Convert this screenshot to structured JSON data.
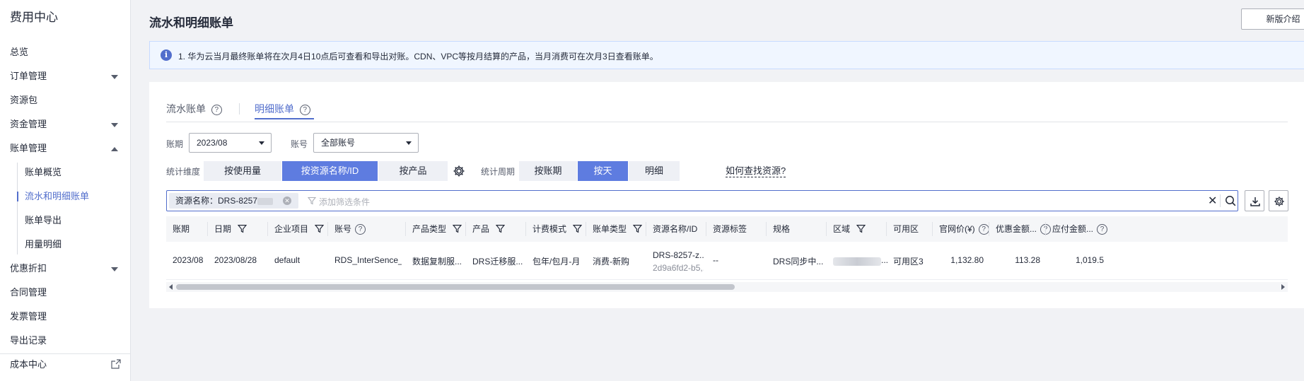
{
  "sidebar": {
    "title": "费用中心",
    "items": [
      {
        "label": "总览",
        "type": "top"
      },
      {
        "label": "订单管理",
        "type": "top",
        "caret": "down"
      },
      {
        "label": "资源包",
        "type": "top"
      },
      {
        "label": "资金管理",
        "type": "top",
        "caret": "down"
      },
      {
        "label": "账单管理",
        "type": "top",
        "caret": "up"
      },
      {
        "label": "账单概览",
        "type": "sub"
      },
      {
        "label": "流水和明细账单",
        "type": "sub",
        "active": true
      },
      {
        "label": "账单导出",
        "type": "sub"
      },
      {
        "label": "用量明细",
        "type": "sub"
      },
      {
        "label": "优惠折扣",
        "type": "top",
        "caret": "down"
      },
      {
        "label": "合同管理",
        "type": "top"
      },
      {
        "label": "发票管理",
        "type": "top"
      },
      {
        "label": "导出记录",
        "type": "top"
      },
      {
        "label": "成本中心",
        "type": "top",
        "external": true
      }
    ]
  },
  "header": {
    "title": "流水和明细账单",
    "intro_button": "新版介绍"
  },
  "notice": {
    "icon": "info-icon",
    "text": "1. 华为云当月最终账单将在次月4日10点后可查看和导出对账。CDN、VPC等按月结算的产品，当月消费可在次月3日查看账单。"
  },
  "tabs": [
    {
      "label": "流水账单",
      "active": false
    },
    {
      "label": "明细账单",
      "active": true
    }
  ],
  "filters": {
    "period_label": "账期",
    "period_value": "2023/08",
    "account_label": "账号",
    "account_value": "全部账号",
    "dimension_label": "统计维度",
    "dimensions": [
      "按使用量",
      "按资源名称/ID",
      "按产品"
    ],
    "dimension_active": 1,
    "cycle_label": "统计周期",
    "cycles": [
      "按账期",
      "按天",
      "明细"
    ],
    "cycle_active": 1,
    "find_resource_link": "如何查找资源?"
  },
  "search": {
    "chip_text": "资源名称：DRS-8257",
    "placeholder": "添加筛选条件"
  },
  "table": {
    "columns": [
      "账期",
      "日期",
      "企业项目",
      "账号",
      "产品类型",
      "产品",
      "计费模式",
      "账单类型",
      "资源名称/ID",
      "资源标签",
      "规格",
      "区域",
      "可用区",
      "官网价(¥)",
      "优惠金额...",
      "应付金额..."
    ],
    "rows": [
      {
        "period": "2023/08",
        "date": "2023/08/28",
        "enterprise_project": "default",
        "account": "RDS_InterSence_...",
        "product_type": "数据复制服...",
        "product": "DRS迁移服...",
        "billing_mode": "包年/包月-月",
        "bill_type": "消费-新购",
        "resource_name": "DRS-8257-z...",
        "resource_id": "2d9a6fd2-b5,...",
        "resource_tag": "--",
        "spec": "DRS同步中...",
        "zone": "可用区3",
        "list_price": "1,132.80",
        "discount": "113.28",
        "payable": "1,019.5"
      }
    ]
  }
}
